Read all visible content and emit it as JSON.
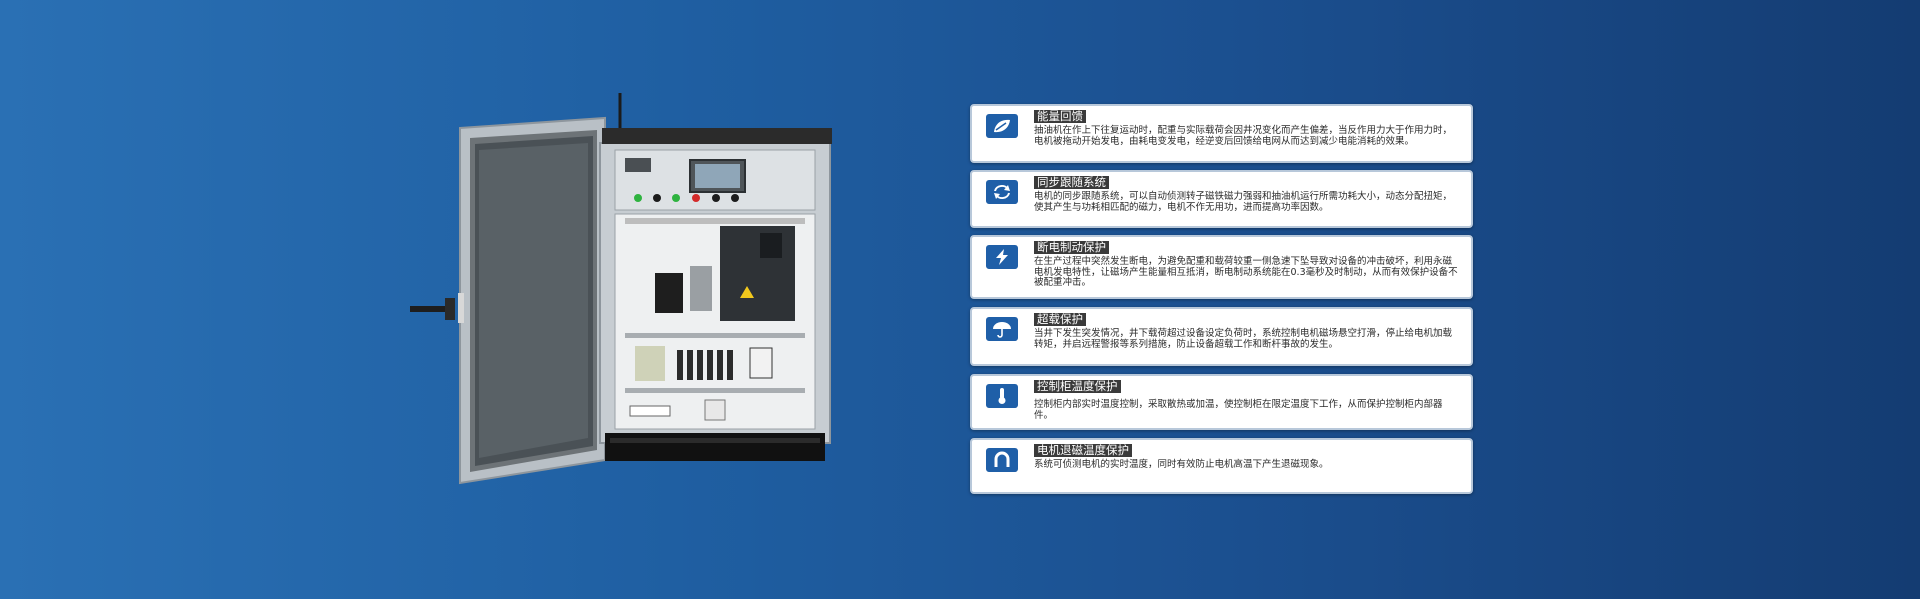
{
  "colors": {
    "background_left": "#2a70b4",
    "background_right": "#143c72",
    "card_bg": "#ffffff",
    "icon_bg": "#1f5fa8",
    "title_bg": "#3a3a3a"
  },
  "product_image": {
    "icon": "electrical-control-cabinet"
  },
  "features": [
    {
      "icon": "leaf-icon",
      "title": "能量回馈",
      "description": "抽油机在作上下往复运动时，配重与实际载荷会因井况变化而产生偏差，当反作用力大于作用力时，电机被拖动开始发电，由耗电变发电，经逆变后回馈给电网从而达到减少电能消耗的效果。"
    },
    {
      "icon": "sync-icon",
      "title": "同步跟随系统",
      "description": "电机的同步跟随系统，可以自动侦测转子磁铁磁力强弱和抽油机运行所需功耗大小，动态分配扭矩，使其产生与功耗相匹配的磁力，电机不作无用功，进而提高功率因数。"
    },
    {
      "icon": "lightning-icon",
      "title": "断电制动保护",
      "description": "在生产过程中突然发生断电，为避免配重和载荷较重一侧急速下坠导致对设备的冲击破坏，利用永磁电机发电特性，让磁场产生能量相互抵消，断电制动系统能在0.3毫秒及时制动，从而有效保护设备不被配重冲击。"
    },
    {
      "icon": "umbrella-icon",
      "title": "超载保护",
      "description": "当井下发生突发情况，井下载荷超过设备设定负荷时，系统控制电机磁场悬空打滑，停止给电机加载转矩，并启远程警报等系列措施，防止设备超载工作和断杆事故的发生。"
    },
    {
      "icon": "thermometer-icon",
      "title": "控制柜温度保护",
      "description": "控制柜内部实时温度控制，采取散热或加温，使控制柜在限定温度下工作，从而保护控制柜内部器件。"
    },
    {
      "icon": "magnet-icon",
      "title": "电机退磁温度保护",
      "description": "系统可侦测电机的实时温度，同时有效防止电机高温下产生退磁现象。"
    }
  ]
}
